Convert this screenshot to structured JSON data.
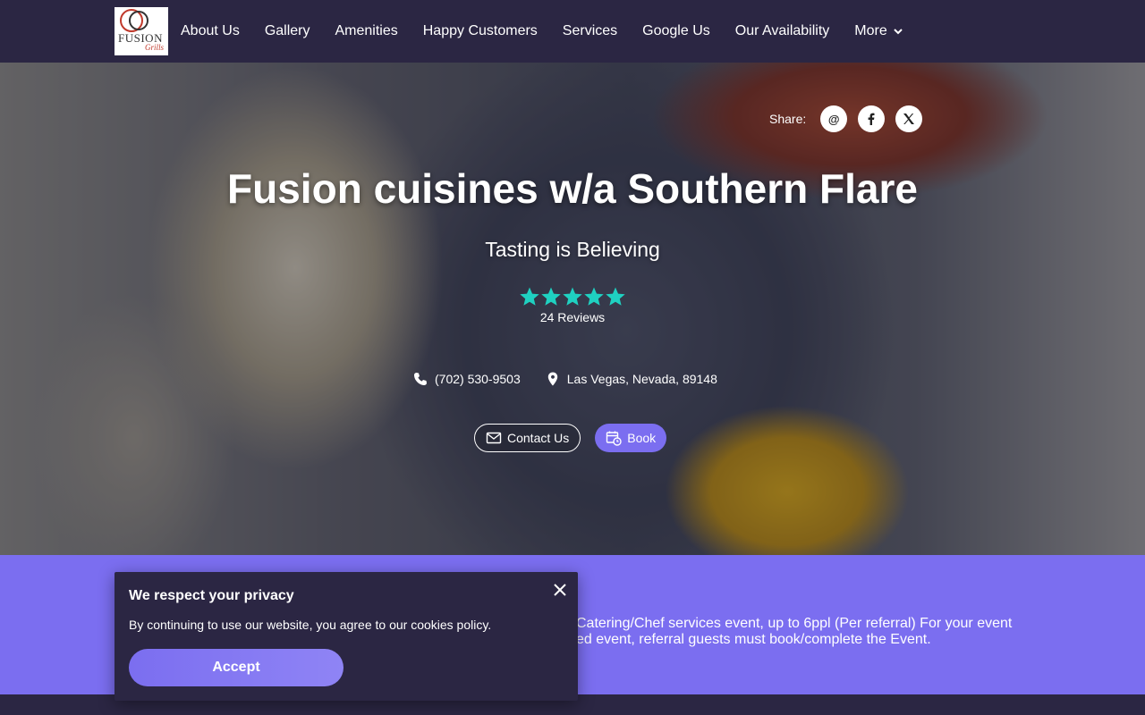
{
  "brand": {
    "logo_text": "FUSION",
    "logo_script": "Grills"
  },
  "nav": {
    "items": [
      "About Us",
      "Gallery",
      "Amenities",
      "Happy Customers",
      "Services",
      "Google Us",
      "Our Availability"
    ],
    "more_label": "More"
  },
  "hero": {
    "share_label": "Share:",
    "share_icons": [
      "email-at-icon",
      "facebook-icon",
      "x-twitter-icon"
    ],
    "title": "Fusion cuisines w/a Southern Flare",
    "subtitle": "Tasting is Believing",
    "rating": {
      "stars": 5,
      "max": 5,
      "color": "#1fd1c1"
    },
    "reviews_label": "24 Reviews",
    "phone": "(702) 530-9503",
    "location": "Las Vegas, Nevada, 89148",
    "contact_button": "Contact Us",
    "book_button": "Book"
  },
  "promo": {
    "line1": "Catering/Chef services event, up to 6ppl (Per referral) For your event",
    "line2": "ed event, referral guests must book/complete the Event."
  },
  "cookie": {
    "title": "We respect your privacy",
    "body": "By continuing to use our website, you agree to our cookies policy.",
    "accept_label": "Accept"
  },
  "colors": {
    "nav_bg": "#2b2643",
    "accent": "#7b6ef0",
    "star": "#1fd1c1"
  }
}
